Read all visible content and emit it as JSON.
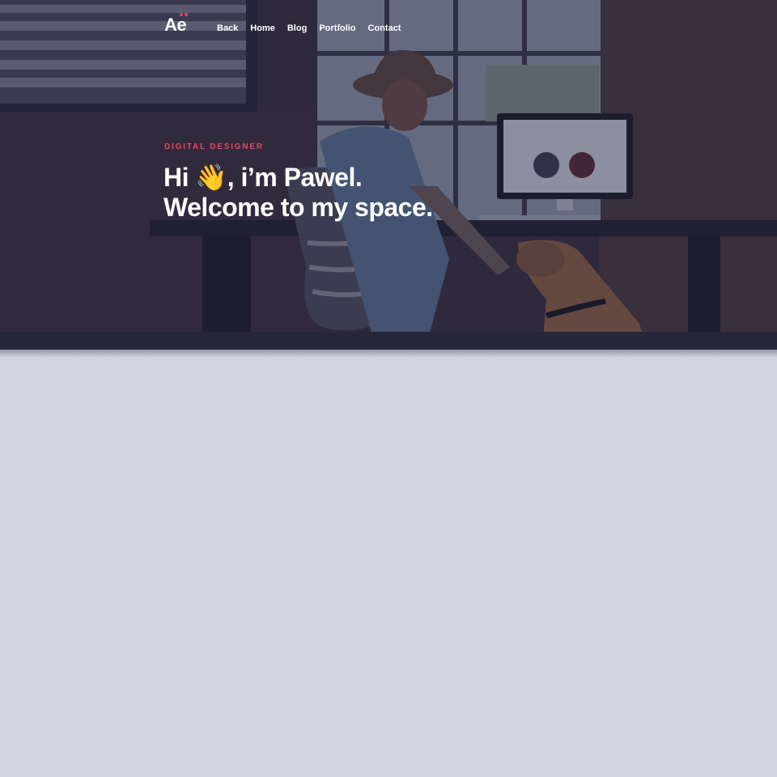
{
  "brand": {
    "logo_text": "Ae",
    "accent_color": "#e8455c"
  },
  "nav": {
    "items": [
      {
        "label": "Back"
      },
      {
        "label": "Home"
      },
      {
        "label": "Blog"
      },
      {
        "label": "Portfolio"
      },
      {
        "label": "Contact"
      }
    ]
  },
  "hero": {
    "eyebrow": "DIGITAL DESIGNER",
    "headline_line1": "Hi 👋, i’m Pawel.",
    "headline_line2": "Welcome to my space.",
    "image_subject": "man in a hat working at a desk with a computer, petting a dog"
  },
  "colors": {
    "page_background": "#d0d6e1",
    "text": "#ffffff"
  }
}
